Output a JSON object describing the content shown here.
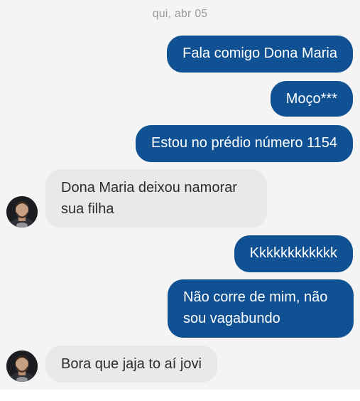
{
  "chat": {
    "date": "qui, abr 05",
    "messages": [
      {
        "from": "me",
        "text": "Fala comigo Dona Maria"
      },
      {
        "from": "me",
        "text": "Moço***"
      },
      {
        "from": "me",
        "text": "Estou no prédio número 1154"
      },
      {
        "from": "contact",
        "lines": [
          "Dona Maria deixou namorar",
          "sua filha"
        ]
      },
      {
        "from": "me",
        "text": "Kkkkkkkkkkkk"
      },
      {
        "from": "me",
        "lines": [
          "Não corre de mim, não",
          "sou vagabundo"
        ]
      },
      {
        "from": "contact",
        "text": "Bora que jaja to aí jovi"
      }
    ]
  },
  "colors": {
    "outgoing_bubble": "#0f5193",
    "incoming_bubble": "#e9e9e9",
    "background": "#f4f4f4",
    "date_text": "#9a9a9a"
  },
  "icons": {
    "avatar": "contact-avatar-photo"
  }
}
